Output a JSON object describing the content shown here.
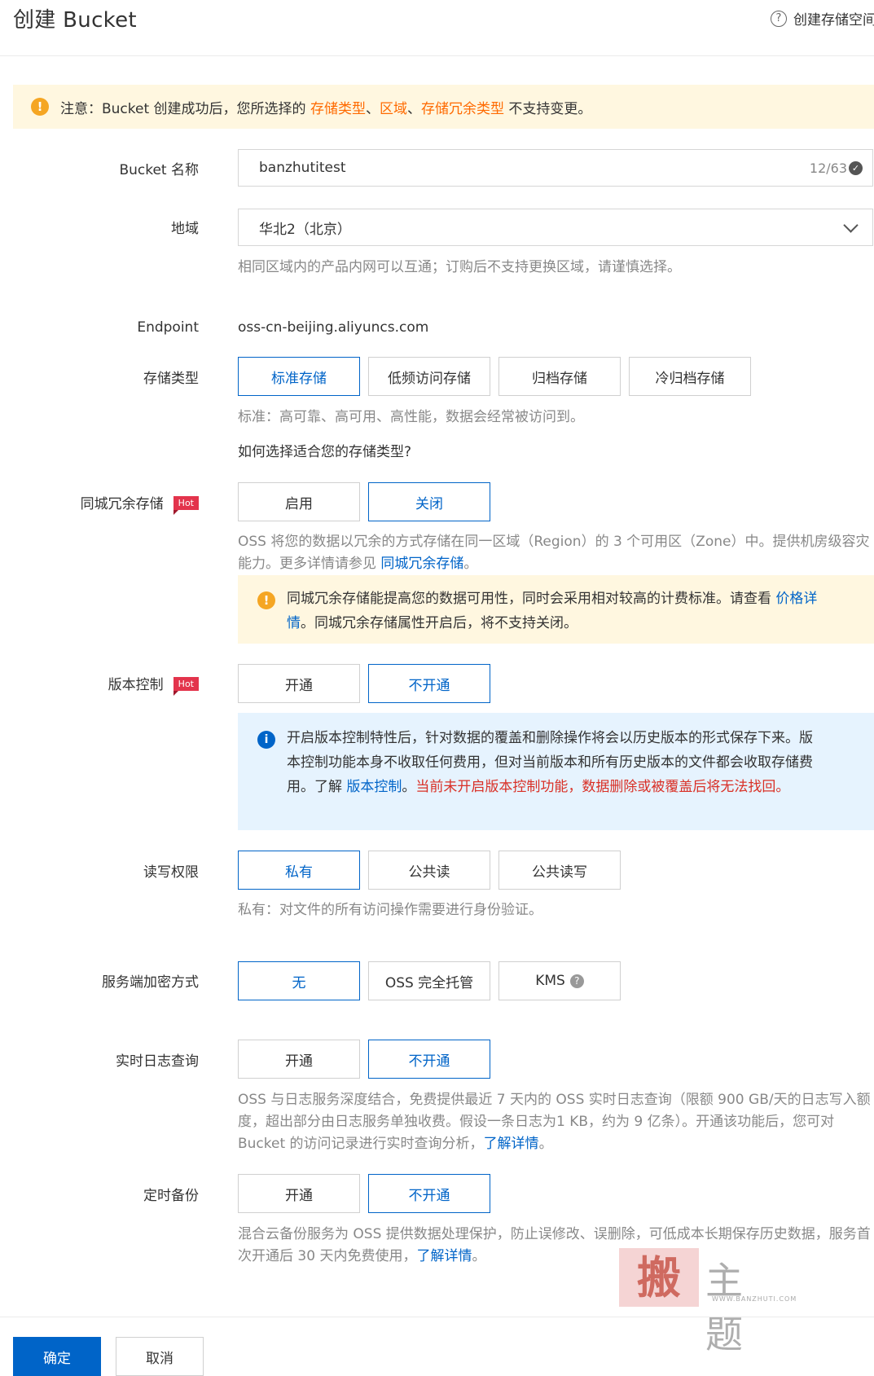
{
  "header": {
    "title": "创建 Bucket",
    "help_label": "创建存储空间"
  },
  "notice": {
    "prefix": "注意：Bucket 创建成功后，您所选择的 ",
    "hl1": "存储类型",
    "sep1": "、",
    "hl2": "区域",
    "sep2": "、",
    "hl3": "存储冗余类型",
    "suffix": " 不支持变更。"
  },
  "form": {
    "bucket_name": {
      "label": "Bucket 名称",
      "value": "banzhutitest",
      "count": "12/63"
    },
    "region": {
      "label": "地域",
      "value": "华北2（北京）",
      "hint": "相同区域内的产品内网可以互通；订购后不支持更换区域，请谨慎选择。"
    },
    "endpoint": {
      "label": "Endpoint",
      "value": "oss-cn-beijing.aliyuncs.com"
    },
    "storage_class": {
      "label": "存储类型",
      "options": [
        "标准存储",
        "低频访问存储",
        "归档存储",
        "冷归档存储"
      ],
      "selected": "标准存储",
      "hint": "标准：高可靠、高可用、高性能，数据会经常被访问到。",
      "link": "如何选择适合您的存储类型?"
    },
    "zrs": {
      "label": "同城冗余存储",
      "hot": "Hot",
      "options": [
        "启用",
        "关闭"
      ],
      "selected": "关闭",
      "hint_1": "OSS 将您的数据以冗余的方式存储在同一区域（Region）的 3 个可用区（Zone）中。提供机房级容灾能力。更多详情请参见 ",
      "hint_link": "同城冗余存储",
      "hint_end": "。",
      "warn_1": "同城冗余存储能提高您的数据可用性，同时会采用相对较高的计费标准。请查看 ",
      "warn_link": "价格详情",
      "warn_2": "。同城冗余存储属性开启后，将不支持关闭。"
    },
    "versioning": {
      "label": "版本控制",
      "hot": "Hot",
      "options": [
        "开通",
        "不开通"
      ],
      "selected": "不开通",
      "info_1": "开启版本控制特性后，针对数据的覆盖和删除操作将会以历史版本的形式保存下来。版本控制功能本身不收取任何费用，但对当前版本和所有历史版本的文件都会收取存储费用。了解 ",
      "info_link": "版本控制",
      "info_end": "。",
      "info_warn": "当前未开启版本控制功能，数据删除或被覆盖后将无法找回。"
    },
    "acl": {
      "label": "读写权限",
      "options": [
        "私有",
        "公共读",
        "公共读写"
      ],
      "selected": "私有",
      "hint": "私有：对文件的所有访问操作需要进行身份验证。"
    },
    "encryption": {
      "label": "服务端加密方式",
      "options": [
        "无",
        "OSS 完全托管",
        "KMS"
      ],
      "selected": "无"
    },
    "realtime_log": {
      "label": "实时日志查询",
      "options": [
        "开通",
        "不开通"
      ],
      "selected": "不开通",
      "hint": "OSS 与日志服务深度结合，免费提供最近 7 天内的 OSS 实时日志查询（限额 900 GB/天的日志写入额度，超出部分由日志服务单独收费。假设一条日志为1 KB，约为 9 亿条）。开通该功能后，您可对 Bucket 的访问记录进行实时查询分析，",
      "link": "了解详情",
      "end": "。"
    },
    "backup": {
      "label": "定时备份",
      "options": [
        "开通",
        "不开通"
      ],
      "selected": "不开通",
      "hint": "混合云备份服务为 OSS 提供数据处理保护，防止误修改、误删除，可低成本长期保存历史数据，服务首次开通后 30 天内免费使用，",
      "link": "了解详情",
      "end": "。"
    }
  },
  "footer": {
    "confirm": "确定",
    "cancel": "取消"
  },
  "watermark": {
    "seal": "搬",
    "text": "主题",
    "url": "WWW.BANZHUTI.COM"
  },
  "colors": {
    "primary": "#0064c8",
    "accent_orange": "#ff6a00",
    "warning_bg": "#fff7e0",
    "info_bg": "#e6f3fe",
    "hot": "#e3344c",
    "danger": "#d93026"
  },
  "icons": {
    "help": "question-circle-icon",
    "warn": "warning-icon",
    "info": "info-icon",
    "valid": "check-circle-icon",
    "dropdown": "chevron-down-icon",
    "kms_help": "question-icon"
  }
}
